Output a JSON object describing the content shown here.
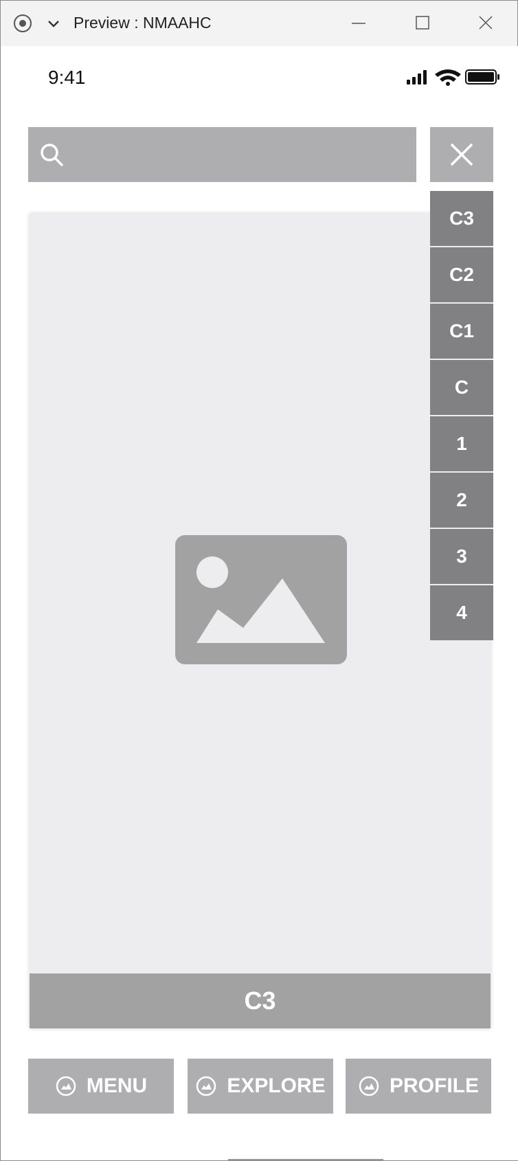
{
  "window": {
    "title": "Preview : NMAAHC"
  },
  "status_bar": {
    "time": "9:41"
  },
  "search": {
    "placeholder": ""
  },
  "card": {
    "caption": "C3"
  },
  "level_list": {
    "items": [
      "C3",
      "C2",
      "C1",
      "C",
      "1",
      "2",
      "3",
      "4"
    ]
  },
  "bottom_nav": {
    "menu_label": "MENU",
    "explore_label": "EXPLORE",
    "profile_label": "PROFILE"
  },
  "colors": {
    "search_bg": "#aeaeb1",
    "level_bg": "#818183",
    "card_bg": "#ededef",
    "caption_bg": "#a2a2a2",
    "nav_bg": "#aeaeb1"
  }
}
